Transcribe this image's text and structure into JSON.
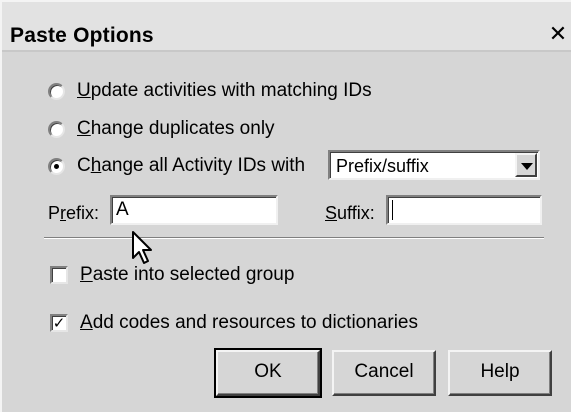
{
  "window": {
    "title": "Paste Options",
    "close_glyph": "✕"
  },
  "options": {
    "update_matching": {
      "label": "Update activities with matching IDs",
      "checked": false
    },
    "change_duplicates": {
      "label": "Change duplicates only",
      "checked": false
    },
    "change_all": {
      "label": "Change all Activity IDs with",
      "checked": true
    }
  },
  "mode_select": {
    "selected": "Prefix/suffix"
  },
  "prefix": {
    "label": "Prefix:",
    "value": "A"
  },
  "suffix": {
    "label": "Suffix:",
    "value": ""
  },
  "paste_into_group": {
    "label": "Paste into selected group",
    "checked": false
  },
  "add_codes": {
    "label": "Add codes and resources to dictionaries",
    "checked": true
  },
  "buttons": {
    "ok": "OK",
    "cancel": "Cancel",
    "help": "Help"
  },
  "icons": {
    "close": "close-icon",
    "dropdown": "chevron-down-icon",
    "pointer": "mouse-pointer-icon"
  }
}
